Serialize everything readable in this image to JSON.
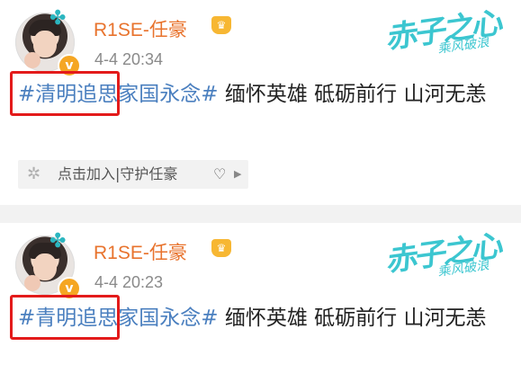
{
  "posts": [
    {
      "author": "R1SE-任豪",
      "time": "4-4 20:34",
      "content_topic_boxed": "#清明追思",
      "content_topic_rest": "家国永念#",
      "content_text": " 缅怀英雄 砥砺前行 山河无恙",
      "super_topic": "点击加入|守护任豪",
      "super_topic_heart": "♡"
    },
    {
      "author": "R1SE-任豪",
      "time": "4-4 20:23",
      "content_topic_boxed": "#青明追思",
      "content_topic_rest": "家国永念#",
      "content_text": " 缅怀英雄 砥砺前行 山河无恙"
    }
  ],
  "banner": {
    "text": "赤子之心",
    "sub": "乘风破浪"
  },
  "icons": {
    "verified": "v-badge-icon",
    "crown": "crown-icon",
    "clover": "clover-icon",
    "super_topic": "flower-icon",
    "arrow": "arrow-right-icon"
  },
  "colors": {
    "name": "#e8732d",
    "topic": "#4a7fbf",
    "highlight_box": "#e31b1b",
    "banner": "#3cc6d0"
  }
}
